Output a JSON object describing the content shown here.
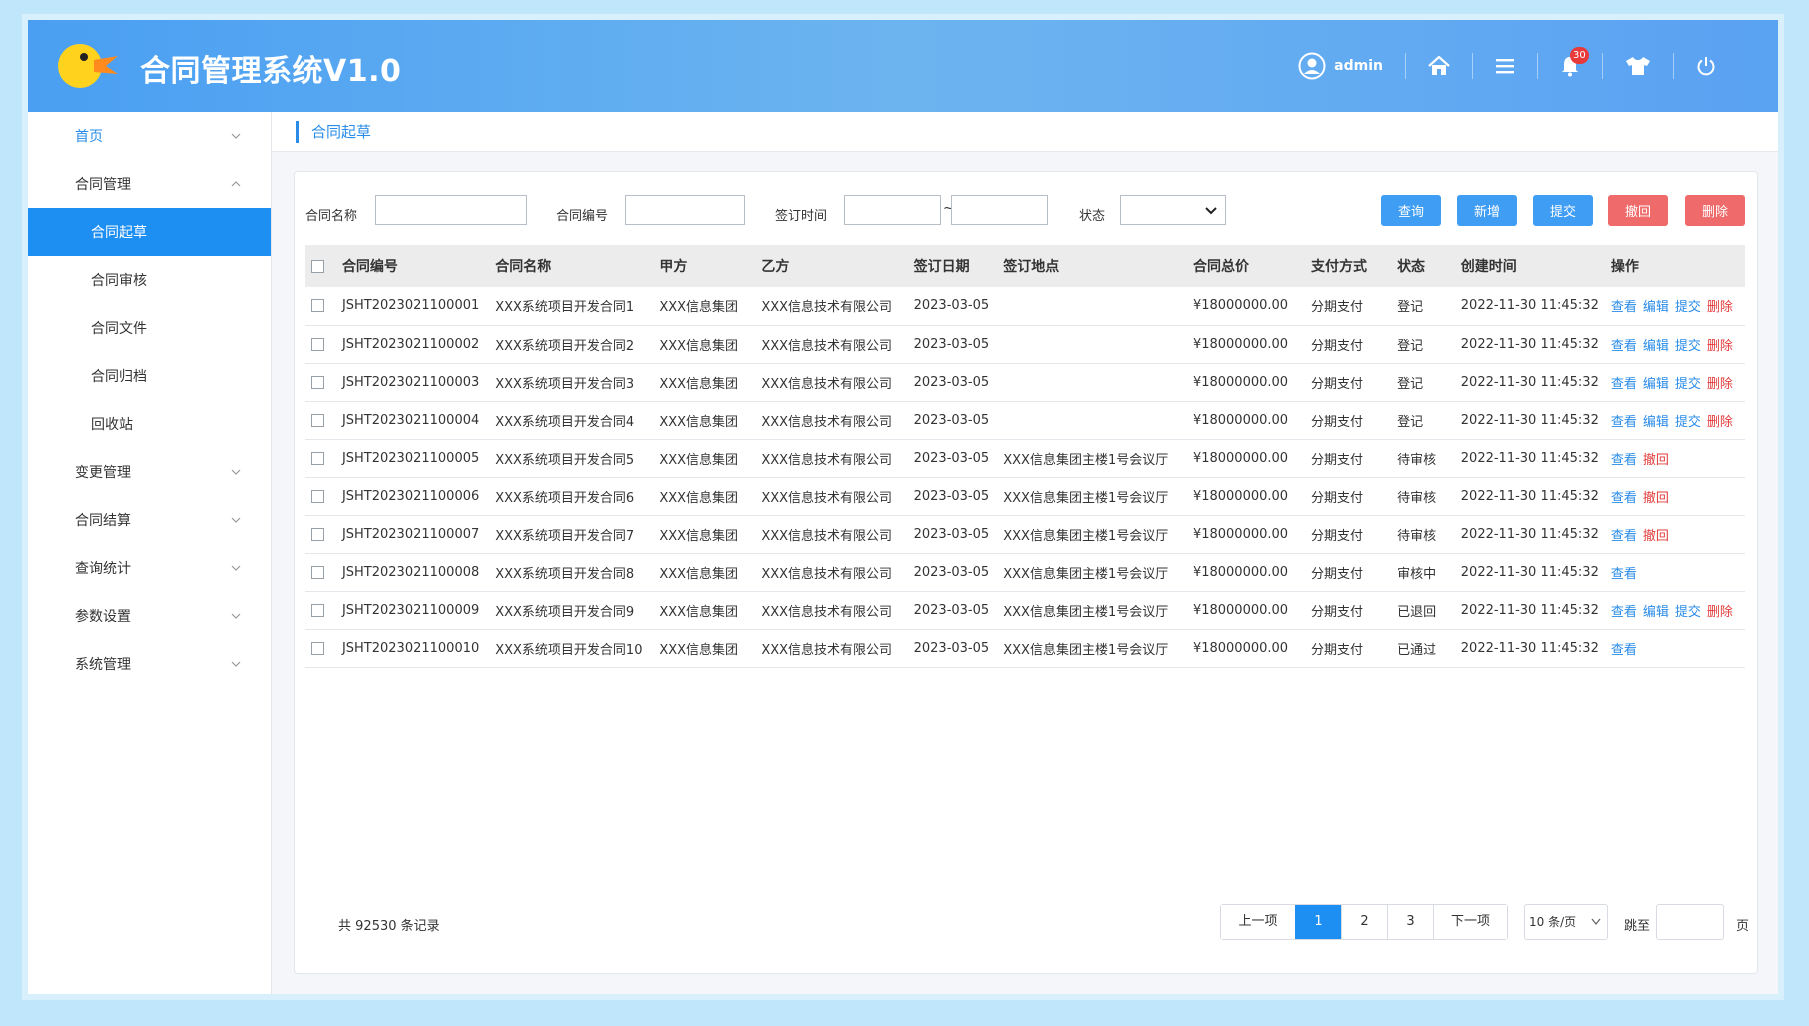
{
  "app": {
    "title": "合同管理系统V1.0",
    "user": "admin",
    "notification_count": "30"
  },
  "sidebar": {
    "items": [
      {
        "label": "首页"
      },
      {
        "label": "合同管理"
      },
      {
        "label": "合同起草"
      },
      {
        "label": "合同审核"
      },
      {
        "label": "合同文件"
      },
      {
        "label": "合同归档"
      },
      {
        "label": "回收站"
      },
      {
        "label": "变更管理"
      },
      {
        "label": "合同结算"
      },
      {
        "label": "查询统计"
      },
      {
        "label": "参数设置"
      },
      {
        "label": "系统管理"
      }
    ]
  },
  "breadcrumb": "合同起草",
  "filters": {
    "name_label": "合同名称",
    "code_label": "合同编号",
    "date_label": "签订时间",
    "date_sep": "~",
    "status_label": "状态",
    "buttons": {
      "query": "查询",
      "add": "新增",
      "submit": "提交",
      "revoke": "撤回",
      "delete": "删除"
    }
  },
  "table": {
    "headers": [
      "合同编号",
      "合同名称",
      "甲方",
      "乙方",
      "签订日期",
      "签订地点",
      "合同总价",
      "支付方式",
      "状态",
      "创建时间",
      "操作"
    ],
    "rows": [
      {
        "code": "JSHT2023021100001",
        "name": "XXX系统项目开发合同1",
        "a": "XXX信息集团",
        "b": "XXX信息技术有限公司",
        "date": "2023-03-05",
        "place": "",
        "price": "¥18000000.00",
        "pay": "分期支付",
        "status": "登记",
        "created": "2022-11-30 11:45:32",
        "ops": [
          "查看",
          "编辑",
          "提交",
          "删除"
        ]
      },
      {
        "code": "JSHT2023021100002",
        "name": "XXX系统项目开发合同2",
        "a": "XXX信息集团",
        "b": "XXX信息技术有限公司",
        "date": "2023-03-05",
        "place": "",
        "price": "¥18000000.00",
        "pay": "分期支付",
        "status": "登记",
        "created": "2022-11-30 11:45:32",
        "ops": [
          "查看",
          "编辑",
          "提交",
          "删除"
        ]
      },
      {
        "code": "JSHT2023021100003",
        "name": "XXX系统项目开发合同3",
        "a": "XXX信息集团",
        "b": "XXX信息技术有限公司",
        "date": "2023-03-05",
        "place": "",
        "price": "¥18000000.00",
        "pay": "分期支付",
        "status": "登记",
        "created": "2022-11-30 11:45:32",
        "ops": [
          "查看",
          "编辑",
          "提交",
          "删除"
        ]
      },
      {
        "code": "JSHT2023021100004",
        "name": "XXX系统项目开发合同4",
        "a": "XXX信息集团",
        "b": "XXX信息技术有限公司",
        "date": "2023-03-05",
        "place": "",
        "price": "¥18000000.00",
        "pay": "分期支付",
        "status": "登记",
        "created": "2022-11-30 11:45:32",
        "ops": [
          "查看",
          "编辑",
          "提交",
          "删除"
        ]
      },
      {
        "code": "JSHT2023021100005",
        "name": "XXX系统项目开发合同5",
        "a": "XXX信息集团",
        "b": "XXX信息技术有限公司",
        "date": "2023-03-05",
        "place": "XXX信息集团主楼1号会议厅",
        "price": "¥18000000.00",
        "pay": "分期支付",
        "status": "待审核",
        "created": "2022-11-30 11:45:32",
        "ops": [
          "查看",
          "撤回"
        ]
      },
      {
        "code": "JSHT2023021100006",
        "name": "XXX系统项目开发合同6",
        "a": "XXX信息集团",
        "b": "XXX信息技术有限公司",
        "date": "2023-03-05",
        "place": "XXX信息集团主楼1号会议厅",
        "price": "¥18000000.00",
        "pay": "分期支付",
        "status": "待审核",
        "created": "2022-11-30 11:45:32",
        "ops": [
          "查看",
          "撤回"
        ]
      },
      {
        "code": "JSHT2023021100007",
        "name": "XXX系统项目开发合同7",
        "a": "XXX信息集团",
        "b": "XXX信息技术有限公司",
        "date": "2023-03-05",
        "place": "XXX信息集团主楼1号会议厅",
        "price": "¥18000000.00",
        "pay": "分期支付",
        "status": "待审核",
        "created": "2022-11-30 11:45:32",
        "ops": [
          "查看",
          "撤回"
        ]
      },
      {
        "code": "JSHT2023021100008",
        "name": "XXX系统项目开发合同8",
        "a": "XXX信息集团",
        "b": "XXX信息技术有限公司",
        "date": "2023-03-05",
        "place": "XXX信息集团主楼1号会议厅",
        "price": "¥18000000.00",
        "pay": "分期支付",
        "status": "审核中",
        "created": "2022-11-30 11:45:32",
        "ops": [
          "查看"
        ]
      },
      {
        "code": "JSHT2023021100009",
        "name": "XXX系统项目开发合同9",
        "a": "XXX信息集团",
        "b": "XXX信息技术有限公司",
        "date": "2023-03-05",
        "place": "XXX信息集团主楼1号会议厅",
        "price": "¥18000000.00",
        "pay": "分期支付",
        "status": "已退回",
        "created": "2022-11-30 11:45:32",
        "ops": [
          "查看",
          "编辑",
          "提交",
          "删除"
        ]
      },
      {
        "code": "JSHT2023021100010",
        "name": "XXX系统项目开发合同10",
        "a": "XXX信息集团",
        "b": "XXX信息技术有限公司",
        "date": "2023-03-05",
        "place": "XXX信息集团主楼1号会议厅",
        "price": "¥18000000.00",
        "pay": "分期支付",
        "status": "已通过",
        "created": "2022-11-30 11:45:32",
        "ops": [
          "查看"
        ]
      }
    ]
  },
  "pagination": {
    "total_prefix": "共",
    "total": "92530",
    "total_suffix": "条记录",
    "prev": "上一项",
    "pages": [
      "1",
      "2",
      "3"
    ],
    "next": "下一项",
    "page_size": "10 条/页",
    "jump_label": "跳至",
    "page_unit": "页"
  },
  "colors": {
    "accent": "#1e8ff2",
    "danger": "#ef6a6a"
  }
}
